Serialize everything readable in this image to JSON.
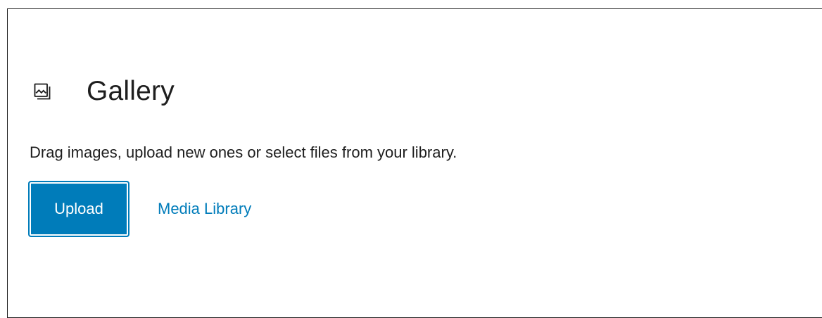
{
  "block": {
    "icon": "gallery-icon",
    "title": "Gallery",
    "instructions": "Drag images, upload new ones or select files from your library.",
    "upload_label": "Upload",
    "media_library_label": "Media Library"
  },
  "colors": {
    "accent": "#007cba",
    "text": "#1e1e1e",
    "border": "#1e1e1e"
  }
}
